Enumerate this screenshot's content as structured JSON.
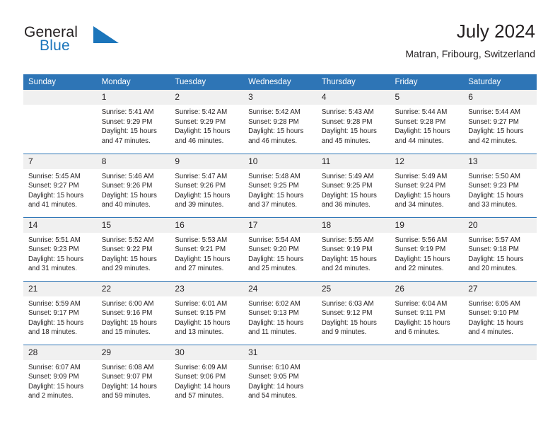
{
  "brand": {
    "name_top": "General",
    "name_bottom": "Blue",
    "triangle_color": "#1b75bb",
    "icon": "triangle-logo-icon"
  },
  "header": {
    "title": "July 2024",
    "subtitle": "Matran, Fribourg, Switzerland"
  },
  "theme": {
    "header_blue": "#2e75b6",
    "daynum_gray": "#f0f0f0",
    "text": "#231f20",
    "brand_blue": "#1b75bb"
  },
  "calendar": {
    "weekday_headers": [
      "Sunday",
      "Monday",
      "Tuesday",
      "Wednesday",
      "Thursday",
      "Friday",
      "Saturday"
    ],
    "weeks": [
      [
        {
          "day": "",
          "sunrise": "",
          "sunset": "",
          "daylight_a": "",
          "daylight_b": ""
        },
        {
          "day": "1",
          "sunrise": "Sunrise: 5:41 AM",
          "sunset": "Sunset: 9:29 PM",
          "daylight_a": "Daylight: 15 hours",
          "daylight_b": "and 47 minutes."
        },
        {
          "day": "2",
          "sunrise": "Sunrise: 5:42 AM",
          "sunset": "Sunset: 9:29 PM",
          "daylight_a": "Daylight: 15 hours",
          "daylight_b": "and 46 minutes."
        },
        {
          "day": "3",
          "sunrise": "Sunrise: 5:42 AM",
          "sunset": "Sunset: 9:28 PM",
          "daylight_a": "Daylight: 15 hours",
          "daylight_b": "and 46 minutes."
        },
        {
          "day": "4",
          "sunrise": "Sunrise: 5:43 AM",
          "sunset": "Sunset: 9:28 PM",
          "daylight_a": "Daylight: 15 hours",
          "daylight_b": "and 45 minutes."
        },
        {
          "day": "5",
          "sunrise": "Sunrise: 5:44 AM",
          "sunset": "Sunset: 9:28 PM",
          "daylight_a": "Daylight: 15 hours",
          "daylight_b": "and 44 minutes."
        },
        {
          "day": "6",
          "sunrise": "Sunrise: 5:44 AM",
          "sunset": "Sunset: 9:27 PM",
          "daylight_a": "Daylight: 15 hours",
          "daylight_b": "and 42 minutes."
        }
      ],
      [
        {
          "day": "7",
          "sunrise": "Sunrise: 5:45 AM",
          "sunset": "Sunset: 9:27 PM",
          "daylight_a": "Daylight: 15 hours",
          "daylight_b": "and 41 minutes."
        },
        {
          "day": "8",
          "sunrise": "Sunrise: 5:46 AM",
          "sunset": "Sunset: 9:26 PM",
          "daylight_a": "Daylight: 15 hours",
          "daylight_b": "and 40 minutes."
        },
        {
          "day": "9",
          "sunrise": "Sunrise: 5:47 AM",
          "sunset": "Sunset: 9:26 PM",
          "daylight_a": "Daylight: 15 hours",
          "daylight_b": "and 39 minutes."
        },
        {
          "day": "10",
          "sunrise": "Sunrise: 5:48 AM",
          "sunset": "Sunset: 9:25 PM",
          "daylight_a": "Daylight: 15 hours",
          "daylight_b": "and 37 minutes."
        },
        {
          "day": "11",
          "sunrise": "Sunrise: 5:49 AM",
          "sunset": "Sunset: 9:25 PM",
          "daylight_a": "Daylight: 15 hours",
          "daylight_b": "and 36 minutes."
        },
        {
          "day": "12",
          "sunrise": "Sunrise: 5:49 AM",
          "sunset": "Sunset: 9:24 PM",
          "daylight_a": "Daylight: 15 hours",
          "daylight_b": "and 34 minutes."
        },
        {
          "day": "13",
          "sunrise": "Sunrise: 5:50 AM",
          "sunset": "Sunset: 9:23 PM",
          "daylight_a": "Daylight: 15 hours",
          "daylight_b": "and 33 minutes."
        }
      ],
      [
        {
          "day": "14",
          "sunrise": "Sunrise: 5:51 AM",
          "sunset": "Sunset: 9:23 PM",
          "daylight_a": "Daylight: 15 hours",
          "daylight_b": "and 31 minutes."
        },
        {
          "day": "15",
          "sunrise": "Sunrise: 5:52 AM",
          "sunset": "Sunset: 9:22 PM",
          "daylight_a": "Daylight: 15 hours",
          "daylight_b": "and 29 minutes."
        },
        {
          "day": "16",
          "sunrise": "Sunrise: 5:53 AM",
          "sunset": "Sunset: 9:21 PM",
          "daylight_a": "Daylight: 15 hours",
          "daylight_b": "and 27 minutes."
        },
        {
          "day": "17",
          "sunrise": "Sunrise: 5:54 AM",
          "sunset": "Sunset: 9:20 PM",
          "daylight_a": "Daylight: 15 hours",
          "daylight_b": "and 25 minutes."
        },
        {
          "day": "18",
          "sunrise": "Sunrise: 5:55 AM",
          "sunset": "Sunset: 9:19 PM",
          "daylight_a": "Daylight: 15 hours",
          "daylight_b": "and 24 minutes."
        },
        {
          "day": "19",
          "sunrise": "Sunrise: 5:56 AM",
          "sunset": "Sunset: 9:19 PM",
          "daylight_a": "Daylight: 15 hours",
          "daylight_b": "and 22 minutes."
        },
        {
          "day": "20",
          "sunrise": "Sunrise: 5:57 AM",
          "sunset": "Sunset: 9:18 PM",
          "daylight_a": "Daylight: 15 hours",
          "daylight_b": "and 20 minutes."
        }
      ],
      [
        {
          "day": "21",
          "sunrise": "Sunrise: 5:59 AM",
          "sunset": "Sunset: 9:17 PM",
          "daylight_a": "Daylight: 15 hours",
          "daylight_b": "and 18 minutes."
        },
        {
          "day": "22",
          "sunrise": "Sunrise: 6:00 AM",
          "sunset": "Sunset: 9:16 PM",
          "daylight_a": "Daylight: 15 hours",
          "daylight_b": "and 15 minutes."
        },
        {
          "day": "23",
          "sunrise": "Sunrise: 6:01 AM",
          "sunset": "Sunset: 9:15 PM",
          "daylight_a": "Daylight: 15 hours",
          "daylight_b": "and 13 minutes."
        },
        {
          "day": "24",
          "sunrise": "Sunrise: 6:02 AM",
          "sunset": "Sunset: 9:13 PM",
          "daylight_a": "Daylight: 15 hours",
          "daylight_b": "and 11 minutes."
        },
        {
          "day": "25",
          "sunrise": "Sunrise: 6:03 AM",
          "sunset": "Sunset: 9:12 PM",
          "daylight_a": "Daylight: 15 hours",
          "daylight_b": "and 9 minutes."
        },
        {
          "day": "26",
          "sunrise": "Sunrise: 6:04 AM",
          "sunset": "Sunset: 9:11 PM",
          "daylight_a": "Daylight: 15 hours",
          "daylight_b": "and 6 minutes."
        },
        {
          "day": "27",
          "sunrise": "Sunrise: 6:05 AM",
          "sunset": "Sunset: 9:10 PM",
          "daylight_a": "Daylight: 15 hours",
          "daylight_b": "and 4 minutes."
        }
      ],
      [
        {
          "day": "28",
          "sunrise": "Sunrise: 6:07 AM",
          "sunset": "Sunset: 9:09 PM",
          "daylight_a": "Daylight: 15 hours",
          "daylight_b": "and 2 minutes."
        },
        {
          "day": "29",
          "sunrise": "Sunrise: 6:08 AM",
          "sunset": "Sunset: 9:07 PM",
          "daylight_a": "Daylight: 14 hours",
          "daylight_b": "and 59 minutes."
        },
        {
          "day": "30",
          "sunrise": "Sunrise: 6:09 AM",
          "sunset": "Sunset: 9:06 PM",
          "daylight_a": "Daylight: 14 hours",
          "daylight_b": "and 57 minutes."
        },
        {
          "day": "31",
          "sunrise": "Sunrise: 6:10 AM",
          "sunset": "Sunset: 9:05 PM",
          "daylight_a": "Daylight: 14 hours",
          "daylight_b": "and 54 minutes."
        },
        {
          "day": "",
          "sunrise": "",
          "sunset": "",
          "daylight_a": "",
          "daylight_b": ""
        },
        {
          "day": "",
          "sunrise": "",
          "sunset": "",
          "daylight_a": "",
          "daylight_b": ""
        },
        {
          "day": "",
          "sunrise": "",
          "sunset": "",
          "daylight_a": "",
          "daylight_b": ""
        }
      ]
    ]
  }
}
